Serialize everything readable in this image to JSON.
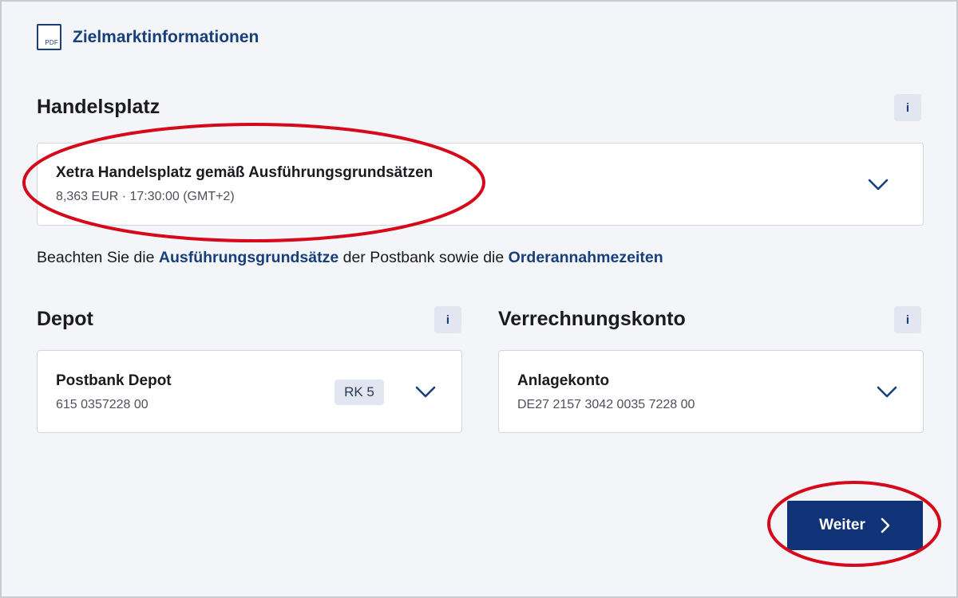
{
  "top_link": {
    "icon": "pdf-file-icon",
    "icon_text": "PDF",
    "label": "Zielmarktinformationen"
  },
  "handelsplatz": {
    "title": "Handelsplatz",
    "info_label": "i",
    "selected_name": "Xetra Handelsplatz gemäß Ausführungsgrundsätzen",
    "selected_detail": "8,363 EUR · 17:30:00 (GMT+2)"
  },
  "notice": {
    "text_before": "Beachten Sie die ",
    "link1": "Ausführungsgrundsätze",
    "text_middle": " der Postbank sowie die ",
    "link2": "Orderannahmezeiten"
  },
  "depot": {
    "title": "Depot",
    "info_label": "i",
    "selected_name": "Postbank Depot",
    "selected_number": "615 0357228 00",
    "risk_badge": "RK 5"
  },
  "verrechnungskonto": {
    "title": "Verrechnungskonto",
    "info_label": "i",
    "selected_name": "Anlagekonto",
    "selected_iban": "DE27 2157 3042 0035 7228 00"
  },
  "footer": {
    "next_label": "Weiter"
  },
  "colors": {
    "brand_blue": "#0f3376",
    "link_blue": "#163f7c",
    "annotation_red": "#d6091a",
    "background": "#f4f5f9"
  }
}
